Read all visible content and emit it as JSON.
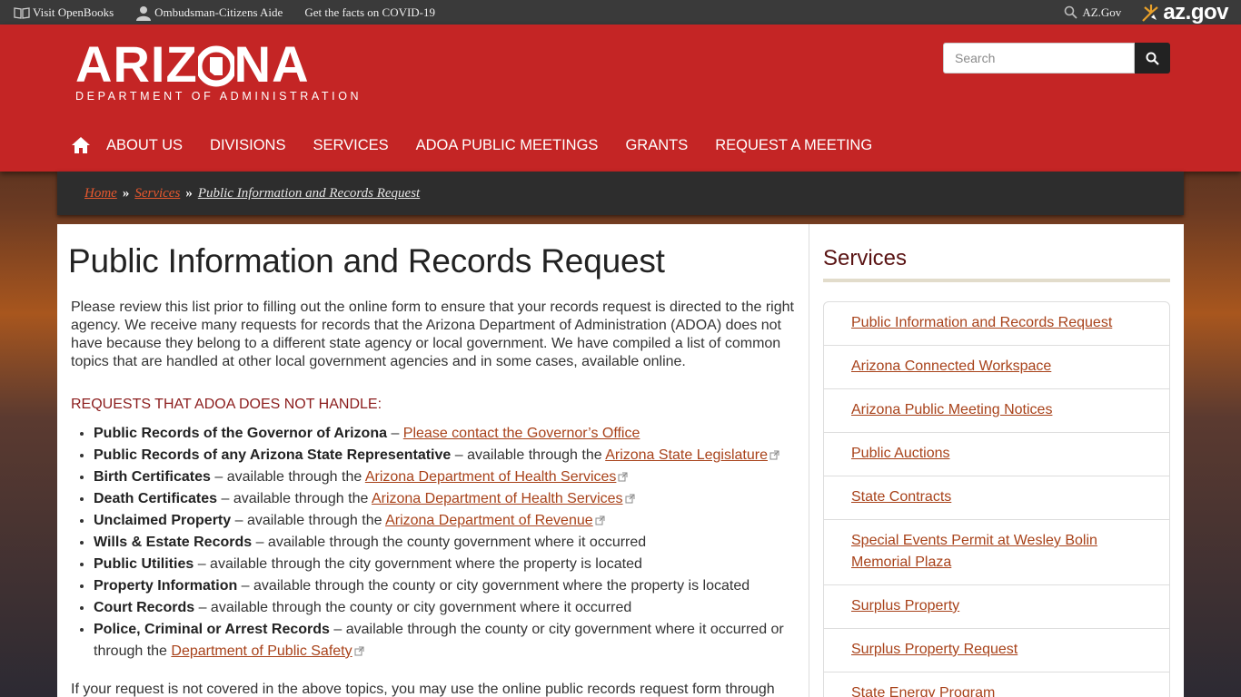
{
  "topbar": {
    "openbooks": "Visit OpenBooks",
    "ombudsman": "Ombudsman-Citizens Aide",
    "covid": "Get the facts on COVID-19",
    "azgov_search": "AZ.Gov",
    "azgov_logo": "az.gov"
  },
  "header": {
    "brand_big_left": "ARIZ",
    "brand_big_right": "NA",
    "brand_small": "DEPARTMENT OF ADMINISTRATION",
    "search_placeholder": "Search"
  },
  "nav": {
    "items": [
      "ABOUT US",
      "DIVISIONS",
      "SERVICES",
      "ADOA PUBLIC MEETINGS",
      "GRANTS",
      "REQUEST A MEETING"
    ]
  },
  "breadcrumb": {
    "home": "Home",
    "sep": "»",
    "services": "Services",
    "current": "Public Information and Records Request"
  },
  "main": {
    "title": "Public Information and Records Request",
    "intro": "Please review this list prior to filling out the online form to ensure that your records request is directed to the right agency. We receive many requests for records that the Arizona Department of Administration (ADOA) does not have because they belong to a different state agency or local government. We have compiled a list of common topics that are handled at other local government agencies and in some cases, available online.",
    "requests_heading": "REQUESTS THAT ADOA DOES NOT HANDLE:",
    "items": [
      {
        "bold": "Public Records of the Governor of Arizona",
        "text": " – ",
        "link": "Please contact the Governor’s Office",
        "ext": false
      },
      {
        "bold": "Public Records of any Arizona State Representative",
        "text": "  – available through the ",
        "link": "Arizona State Legislature",
        "ext": true
      },
      {
        "bold": "Birth Certificates",
        "text": " – available through the ",
        "link": "Arizona Department of Health Services",
        "ext": true
      },
      {
        "bold": "Death Certificates",
        "text": " – available through the ",
        "link": "Arizona Department of Health Services",
        "ext": true
      },
      {
        "bold": "Unclaimed Property",
        "text": " – available through the ",
        "link": "Arizona Department of Revenue",
        "ext": true
      },
      {
        "bold": "Wills & Estate Records",
        "text": " – available through the county government where it occurred",
        "link": "",
        "ext": false
      },
      {
        "bold": "Public Utilities",
        "text": " – available through the city government where the property is located",
        "link": "",
        "ext": false
      },
      {
        "bold": "Property Information",
        "text": " – available through the county or city government where the property is located",
        "link": "",
        "ext": false
      },
      {
        "bold": "Court Records",
        "text": " – available through the county or city government where it occurred",
        "link": "",
        "ext": false
      },
      {
        "bold": "Police, Criminal or Arrest Records",
        "text": " – available through the county or city government where it occurred or through the ",
        "link": "Department of Public Safety",
        "ext": true
      }
    ],
    "outro": "If your request is not covered in the above topics, you may use the online public records request form through"
  },
  "sidebar": {
    "title": "Services",
    "links": [
      "Public Information and Records Request",
      "Arizona Connected Workspace",
      "Arizona Public Meeting Notices",
      "Public Auctions",
      "State Contracts",
      "Special Events Permit at Wesley Bolin Memorial Plaza",
      "Surplus Property",
      "Surplus Property Request",
      "State Energy Program"
    ]
  },
  "colors": {
    "header_red": "#c42525",
    "link": "#a8421a",
    "crumb_link": "#e8582e"
  }
}
